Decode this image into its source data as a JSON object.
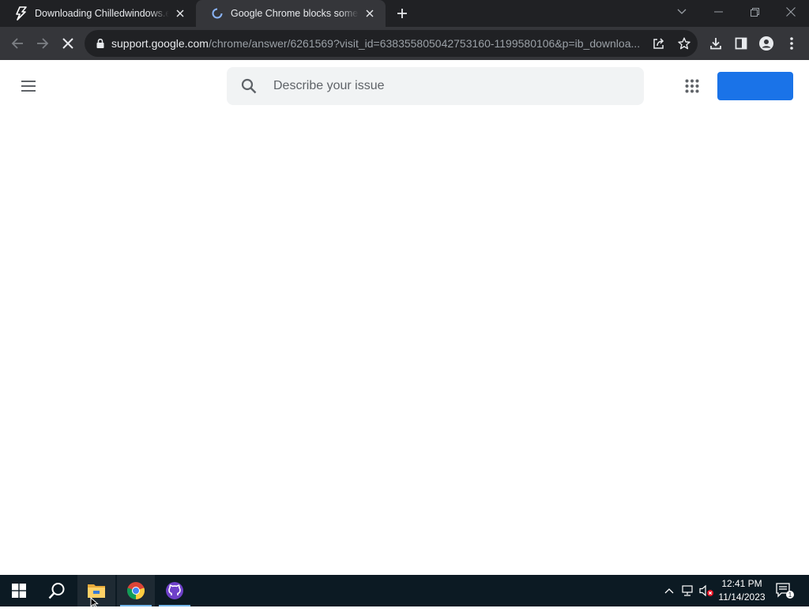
{
  "browser": {
    "tabs": [
      {
        "title": "Downloading Chilledwindows.exe",
        "favicon": "lightning-icon",
        "active": false
      },
      {
        "title": "Google Chrome blocks some downloads",
        "favicon": "loading-spinner-icon",
        "active": true
      }
    ],
    "url_host": "support.google.com",
    "url_path": "/chrome/answer/6261569?visit_id=638355805042753160-1199580106&p=ib_downloa..."
  },
  "page": {
    "search_placeholder": "Describe your issue",
    "signin_label": ""
  },
  "taskbar": {
    "time": "12:41 PM",
    "date": "11/14/2023",
    "notification_count": "1"
  },
  "colors": {
    "tabstrip": "#202124",
    "toolbar": "#35363a",
    "accent": "#1a73e8",
    "taskbar": "#0c1a23"
  }
}
